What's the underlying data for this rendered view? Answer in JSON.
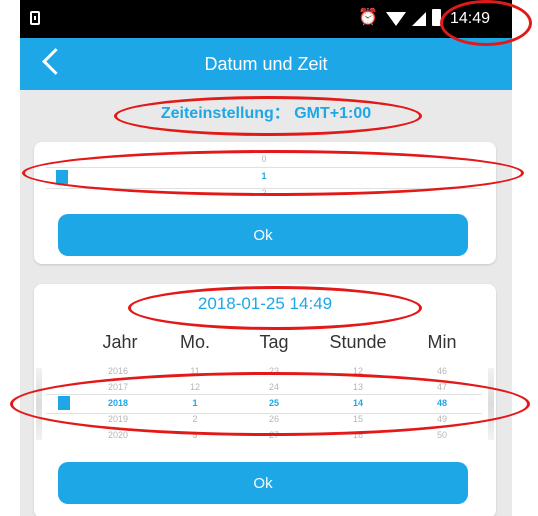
{
  "status_bar": {
    "time": "14:49",
    "icons": [
      "sim-icon",
      "alarm-icon",
      "wifi-icon",
      "signal-icon",
      "battery-icon"
    ]
  },
  "app_bar": {
    "title": "Datum und Zeit",
    "back_icon": "back-arrow-icon"
  },
  "timezone": {
    "label": "Zeiteinstellung： GMT+1:00"
  },
  "offset_picker": {
    "above": "0",
    "selected": "1",
    "below": "2"
  },
  "buttons": {
    "ok1": "Ok",
    "ok2": "Ok"
  },
  "datetime": {
    "current": "2018-01-25 14:49",
    "columns": [
      {
        "header": "Jahr",
        "values": [
          "2016",
          "2017",
          "2018",
          "2019",
          "2020"
        ],
        "selected": "2018"
      },
      {
        "header": "Mo.",
        "values": [
          "11",
          "12",
          "1",
          "2",
          "3"
        ],
        "selected": "1"
      },
      {
        "header": "Tag",
        "values": [
          "23",
          "24",
          "25",
          "26",
          "27"
        ],
        "selected": "25"
      },
      {
        "header": "Stunde",
        "values": [
          "12",
          "13",
          "14",
          "15",
          "16"
        ],
        "selected": "14"
      },
      {
        "header": "Min",
        "values": [
          "46",
          "47",
          "48",
          "49",
          "50"
        ],
        "selected": "48"
      }
    ]
  },
  "colors": {
    "accent": "#1ea7e6",
    "annotation": "#e31818"
  }
}
